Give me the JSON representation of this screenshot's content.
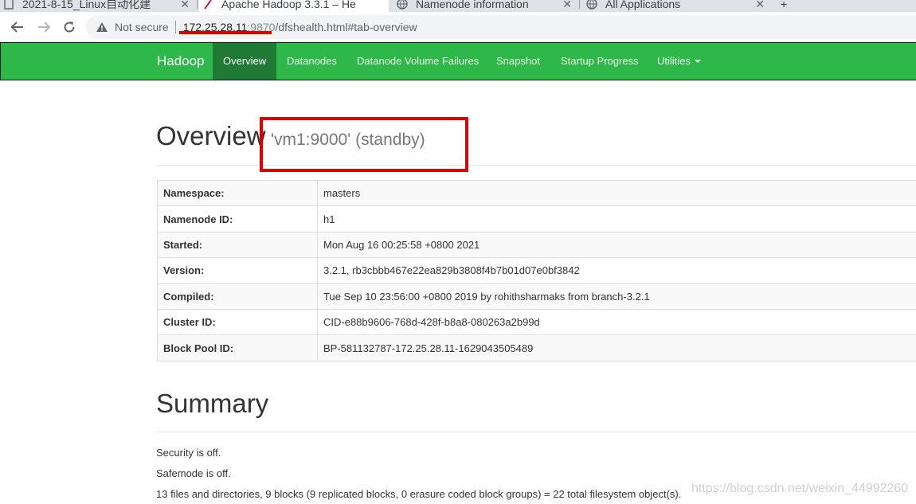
{
  "browser": {
    "tabs": [
      {
        "title": "2021-8-15_Linux自动化建",
        "active": false
      },
      {
        "title": "Apache Hadoop 3.3.1 – He",
        "active": true
      },
      {
        "title": "Namenode information",
        "active": false
      },
      {
        "title": "All Applications",
        "active": false
      }
    ],
    "new_tab_label": "+",
    "security_label": "Not secure",
    "url_host": "172.25.28.11",
    "url_port": ":9870",
    "url_path": "/dfshealth.html#tab-overview"
  },
  "navbar": {
    "brand": "Hadoop",
    "items": [
      {
        "label": "Overview",
        "active": true
      },
      {
        "label": "Datanodes",
        "active": false
      },
      {
        "label": "Datanode Volume Failures",
        "active": false
      },
      {
        "label": "Snapshot",
        "active": false
      },
      {
        "label": "Startup Progress",
        "active": false
      },
      {
        "label": "Utilities",
        "active": false,
        "dropdown": true
      }
    ]
  },
  "overview": {
    "title": "Overview",
    "subtitle": "'vm1:9000' (standby)",
    "rows": [
      {
        "key": "Namespace:",
        "value": "masters"
      },
      {
        "key": "Namenode ID:",
        "value": "h1"
      },
      {
        "key": "Started:",
        "value": "Mon Aug 16 00:25:58 +0800 2021"
      },
      {
        "key": "Version:",
        "value": "3.2.1, rb3cbbb467e22ea829b3808f4b7b01d07e0bf3842"
      },
      {
        "key": "Compiled:",
        "value": "Tue Sep 10 23:56:00 +0800 2019 by rohithsharmaks from branch-3.2.1"
      },
      {
        "key": "Cluster ID:",
        "value": "CID-e88b9606-768d-428f-b8a8-080263a2b99d"
      },
      {
        "key": "Block Pool ID:",
        "value": "BP-581132787-172.25.28.11-1629043505489"
      }
    ]
  },
  "summary": {
    "title": "Summary",
    "lines": [
      "Security is off.",
      "Safemode is off.",
      "13 files and directories, 9 blocks (9 replicated blocks, 0 erasure coded block groups) = 22 total filesystem object(s)."
    ]
  },
  "watermark": "https://blog.csdn.net/weixin_44992260",
  "colors": {
    "navbar": "#2fb84a",
    "navbar_active": "#1f7a35",
    "annotation_red": "#e00000"
  }
}
